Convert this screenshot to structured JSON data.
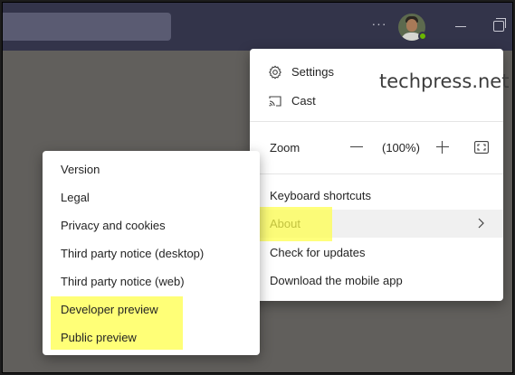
{
  "watermark": "techpress.net",
  "menu": {
    "settings": "Settings",
    "cast": "Cast",
    "zoom_label": "Zoom",
    "zoom_value": "(100%)",
    "keyboard_shortcuts": "Keyboard shortcuts",
    "about": "About",
    "check_updates": "Check for updates",
    "download_mobile": "Download the mobile app"
  },
  "about_submenu": {
    "items": [
      "Version",
      "Legal",
      "Privacy and cookies",
      "Third party notice (desktop)",
      "Third party notice (web)",
      "Developer preview",
      "Public preview"
    ]
  },
  "titlebar": {
    "more_glyph": "···",
    "presence_status": "available"
  },
  "icons": {
    "settings": "gear-icon",
    "cast": "cast-icon",
    "zoom_out": "minus-icon",
    "zoom_in": "plus-icon",
    "fullscreen": "fullscreen-icon",
    "about_expand": "chevron-right-icon"
  },
  "colors": {
    "titlebar": "#33344a",
    "highlight": "#ffff4a",
    "backdrop": "#615f5c",
    "presence": "#6bb700"
  }
}
